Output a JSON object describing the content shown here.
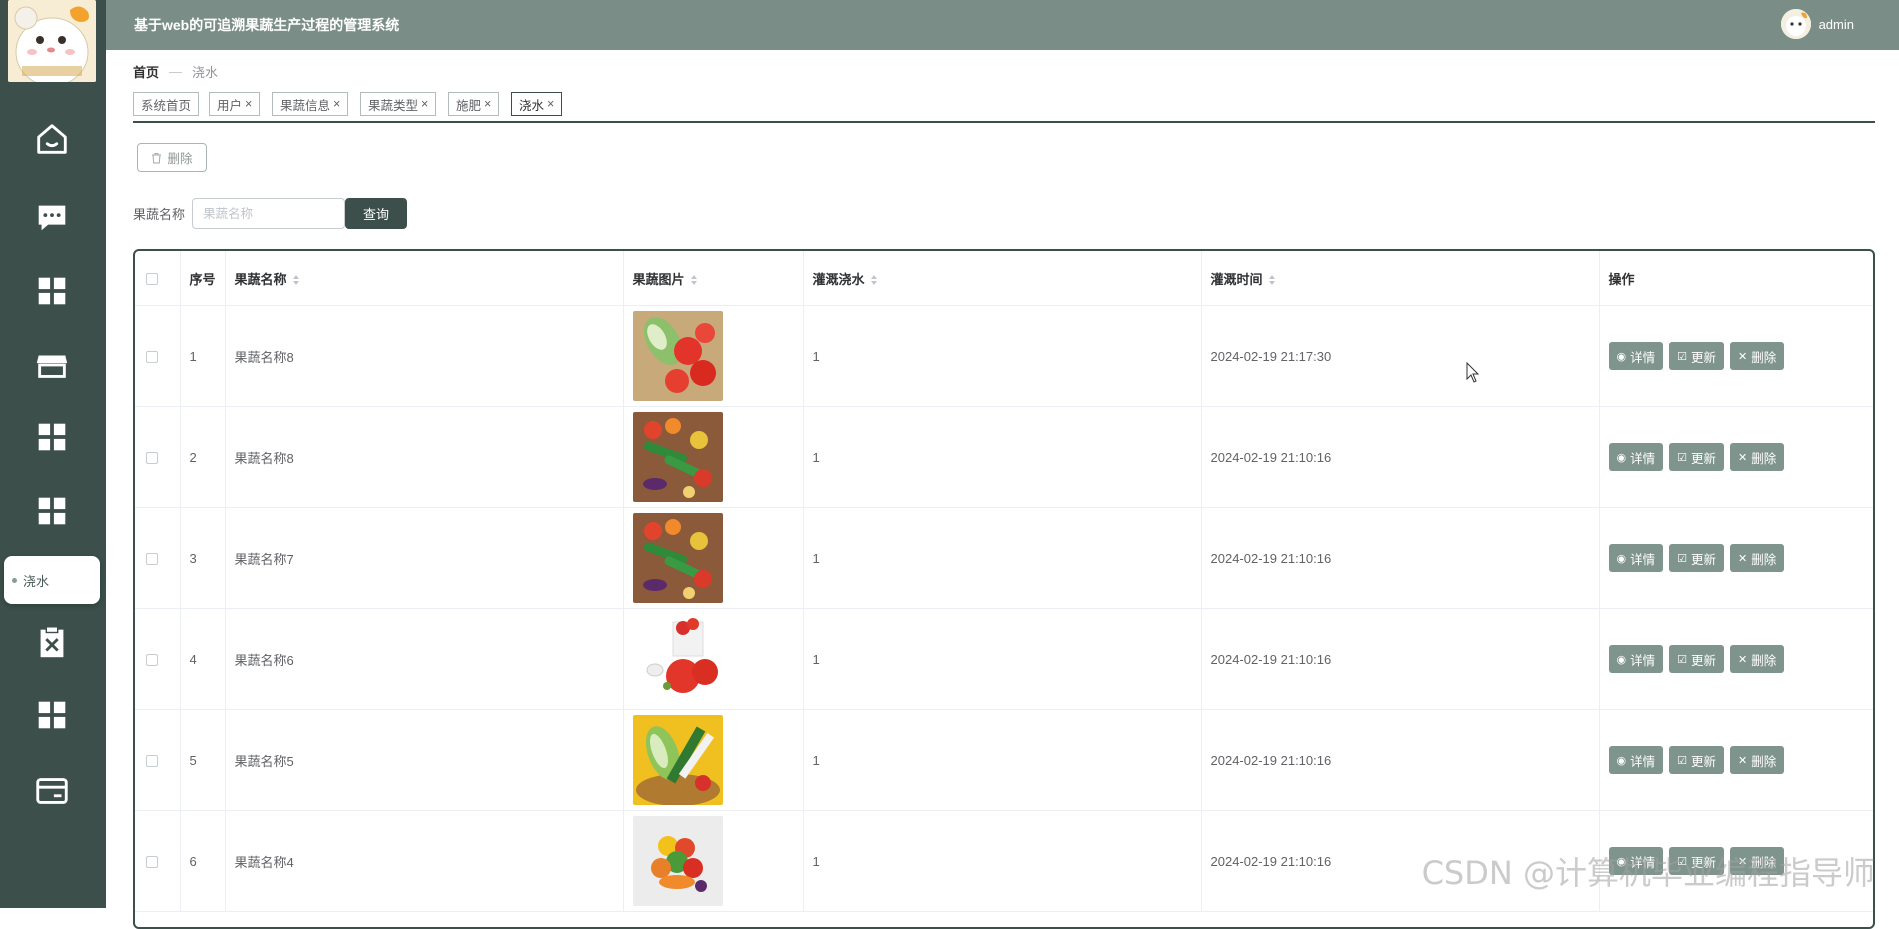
{
  "header": {
    "title": "基于web的可追溯果蔬生产过程的管理系统",
    "username": "admin"
  },
  "sidebar": {
    "items": [
      {
        "icon": "home-icon"
      },
      {
        "icon": "chat-icon"
      },
      {
        "icon": "grid-icon"
      },
      {
        "icon": "store-icon"
      },
      {
        "icon": "grid-icon"
      },
      {
        "icon": "grid-icon"
      },
      {
        "icon": "clipboard-x-icon"
      },
      {
        "icon": "grid-icon"
      },
      {
        "icon": "card-icon"
      }
    ],
    "popup_label": "浇水"
  },
  "breadcrumb": {
    "home": "首页",
    "separator": "—",
    "current": "浇水"
  },
  "tabs": [
    {
      "label": "系统首页",
      "closable": false
    },
    {
      "label": "用户",
      "closable": true
    },
    {
      "label": "果蔬信息",
      "closable": true
    },
    {
      "label": "果蔬类型",
      "closable": true
    },
    {
      "label": "施肥",
      "closable": true
    },
    {
      "label": "浇水",
      "closable": true,
      "active": true
    }
  ],
  "toolbar": {
    "delete_label": "删除"
  },
  "search": {
    "label": "果蔬名称",
    "placeholder": "果蔬名称",
    "button": "查询"
  },
  "table": {
    "columns": [
      "序号",
      "果蔬名称",
      "果蔬图片",
      "灌溉浇水",
      "灌溉时间",
      "操作"
    ],
    "rows": [
      {
        "index": "1",
        "name": "果蔬名称8",
        "water": "1",
        "time": "2024-02-19 21:17:30",
        "image": "cucumber-tomato"
      },
      {
        "index": "2",
        "name": "果蔬名称8",
        "water": "1",
        "time": "2024-02-19 21:10:16",
        "image": "mixed-vegetables"
      },
      {
        "index": "3",
        "name": "果蔬名称7",
        "water": "1",
        "time": "2024-02-19 21:10:16",
        "image": "mixed-vegetables"
      },
      {
        "index": "4",
        "name": "果蔬名称6",
        "water": "1",
        "time": "2024-02-19 21:10:16",
        "image": "tomatoes-white"
      },
      {
        "index": "5",
        "name": "果蔬名称5",
        "water": "1",
        "time": "2024-02-19 21:10:16",
        "image": "basket-vegetables"
      },
      {
        "index": "6",
        "name": "果蔬名称4",
        "water": "1",
        "time": "2024-02-19 21:10:16",
        "image": "pepper-pile"
      }
    ],
    "actions": {
      "detail": "详情",
      "update": "更新",
      "delete": "删除"
    }
  },
  "watermark": "CSDN @计算机毕业编程指导师",
  "colors": {
    "sidebar": "#3c4f4b",
    "header": "#7a8e87",
    "action_button": "#7f948d",
    "primary": "#3c4f4b"
  }
}
